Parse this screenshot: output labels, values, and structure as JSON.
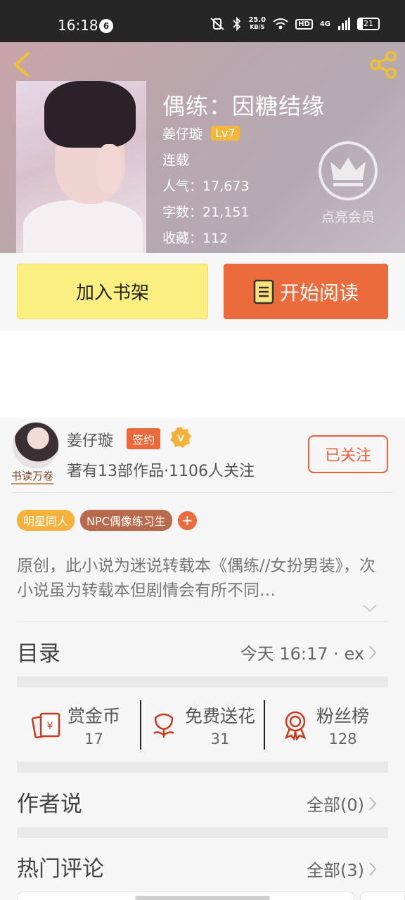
{
  "status_bar": {
    "time": "16:18",
    "notification_count": "6",
    "network_speed_value": "25.0",
    "network_speed_unit": "KB/S",
    "hd_label": "HD",
    "network_label": "4G",
    "battery_level": "21"
  },
  "book": {
    "title": "偶练：因糖结缘",
    "author": "姜仔璇",
    "author_level": "Lv7",
    "status": "连载",
    "popularity": "人气：17,673",
    "word_count": "字数：21,151",
    "favorites": "收藏：112"
  },
  "vip": {
    "label": "点亮会员"
  },
  "actions": {
    "add_to_shelf": "加入书架",
    "start_reading": "开始阅读"
  },
  "author_card": {
    "name": "姜仔璇",
    "signed_badge": "签约",
    "verified_badge": "V",
    "avatar_badge": "书读万卷",
    "works_followers": "著有13部作品·1106人关注",
    "follow_button": "已关注"
  },
  "tags": [
    "明星同人",
    "NPC偶像练习生"
  ],
  "tag_add": "+",
  "description": "原创，此小说为迷说转载本《偶练//女扮男装》，次小说虽为转载本但剧情会有所不同…",
  "catalog": {
    "title": "目录",
    "latest": "今天 16:17 · ex"
  },
  "stats": [
    {
      "label": "赏金币",
      "value": "17",
      "icon": "red-envelope-icon"
    },
    {
      "label": "免费送花",
      "value": "31",
      "icon": "flower-icon"
    },
    {
      "label": "粉丝榜",
      "value": "128",
      "icon": "medal-icon"
    }
  ],
  "author_says": {
    "title": "作者说",
    "all": "全部(0)"
  },
  "hot_comments": {
    "title": "热门评论",
    "all": "全部(3)"
  },
  "colors": {
    "accent_orange": "#ec6b3c",
    "shelf_yellow": "#fbef82",
    "tag_yellow": "#f4b23c",
    "tag_brown": "#b76a4c",
    "level_badge": "#f2b73c"
  }
}
